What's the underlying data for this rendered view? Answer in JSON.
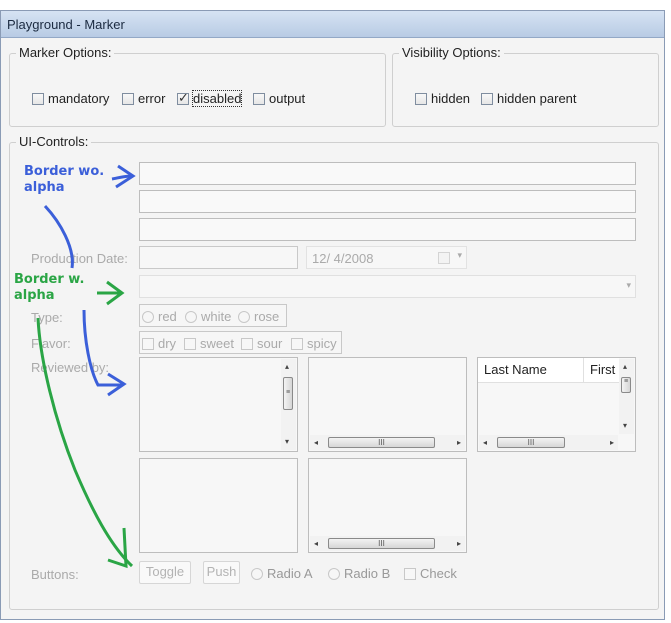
{
  "window": {
    "title": "Playground - Marker"
  },
  "marker_options": {
    "legend": "Marker Options:",
    "items": [
      {
        "label": "mandatory",
        "checked": false
      },
      {
        "label": "error",
        "checked": false
      },
      {
        "label": "disabled",
        "checked": true
      },
      {
        "label": "output",
        "checked": false
      }
    ]
  },
  "visibility_options": {
    "legend": "Visibility Options:",
    "items": [
      {
        "label": "hidden",
        "checked": false
      },
      {
        "label": "hidden parent",
        "checked": false
      }
    ]
  },
  "ui_controls": {
    "legend": "UI-Controls:",
    "production_date_label": "Production Date:",
    "date_value": "12/  4/2008",
    "type_label": "Type:",
    "type_options": [
      "red",
      "white",
      "rose"
    ],
    "flavor_label": "Flavor:",
    "flavor_options": [
      "dry",
      "sweet",
      "sour",
      "spicy"
    ],
    "reviewed_by_label": "Reviewed by:",
    "table_columns": [
      "Last Name",
      "First"
    ],
    "scroll_thumb_grip": "III",
    "buttons_label": "Buttons:",
    "toggle_label": "Toggle",
    "push_label": "Push",
    "radio_a_label": "Radio A",
    "radio_b_label": "Radio B",
    "check_label": "Check"
  },
  "annotations": {
    "without_alpha_line1": "Border wo.",
    "without_alpha_line2": "alpha",
    "with_alpha_line1": "Border w.",
    "with_alpha_line2": "alpha"
  },
  "colors": {
    "annotation_blue": "#3b5fd9",
    "annotation_green": "#2aa545"
  }
}
